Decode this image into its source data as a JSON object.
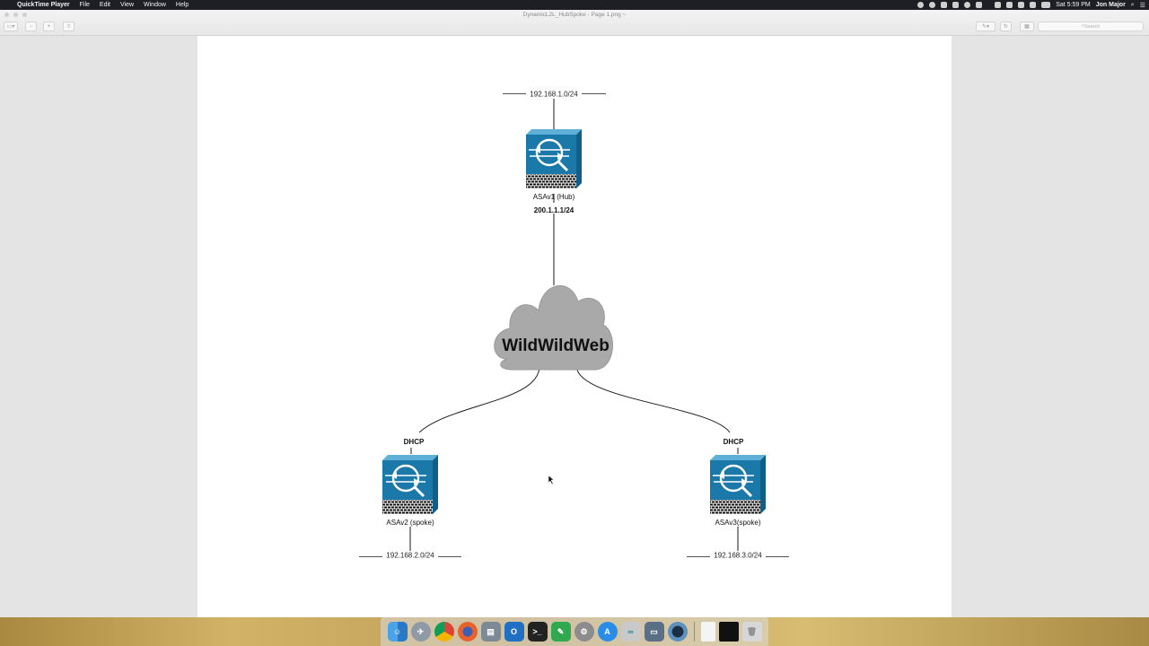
{
  "menubar": {
    "app_name": "QuickTime Player",
    "menus": [
      "File",
      "Edit",
      "View",
      "Window",
      "Help"
    ],
    "clock": "Sat 5:59 PM",
    "user": "Jon Major"
  },
  "window": {
    "title": "DynamicL2L_HubSpoke - Page 1.png ~",
    "search_placeholder": "Search"
  },
  "diagram": {
    "hub": {
      "label": "ASAv1 (Hub)",
      "wan_ip": "200.1.1.1/24",
      "lan": "192.168.1.0/24"
    },
    "cloud": {
      "label": "WildWildWeb"
    },
    "spoke1": {
      "label": "ASAv2 (spoke)",
      "wan": "DHCP",
      "lan": "192.168.2.0/24"
    },
    "spoke2": {
      "label": "ASAv3(spoke)",
      "wan": "DHCP",
      "lan": "192.168.3.0/24"
    }
  },
  "colors": {
    "firewall_blue": "#1b79a9",
    "cloud_gray": "#a9a9a9"
  },
  "dock": {
    "apps": [
      "finder-icon",
      "launchpad-icon",
      "chrome-icon",
      "firefox-icon",
      "preview-icon",
      "outlook-icon",
      "terminal-icon",
      "evernote-icon",
      "system-preferences-icon",
      "app-store-icon",
      "anyconnect-icon",
      "image-capture-icon",
      "quicktime-icon",
      "document-icon",
      "screen-icon",
      "trash-icon"
    ]
  }
}
